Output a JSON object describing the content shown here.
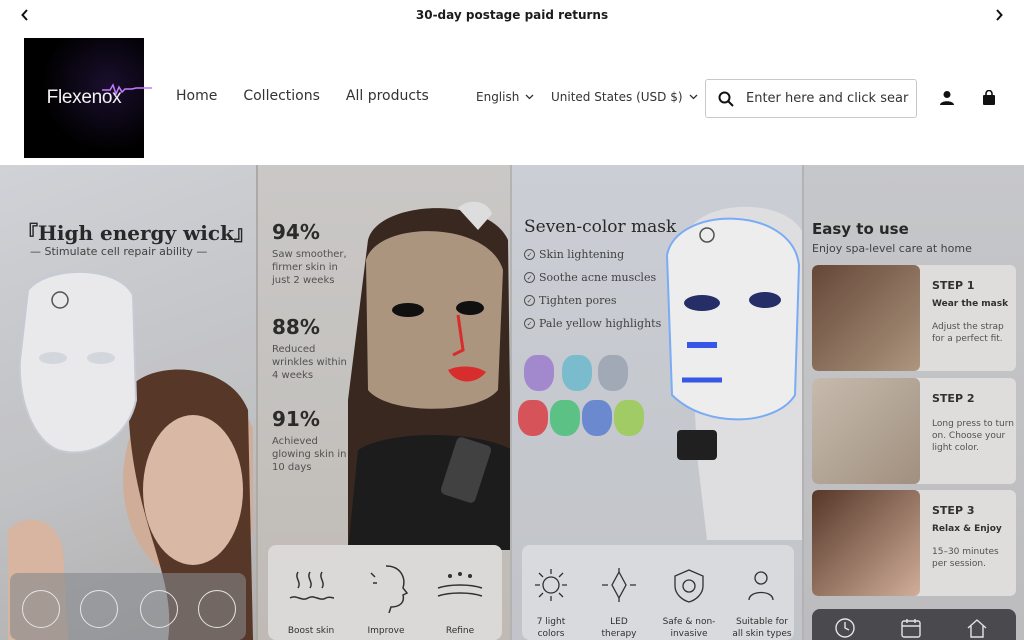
{
  "announcement": {
    "text": "30-day postage paid returns"
  },
  "brand": {
    "name": "Flexenox"
  },
  "nav": {
    "items": [
      {
        "label": "Home"
      },
      {
        "label": "Collections"
      },
      {
        "label": "All products"
      }
    ]
  },
  "language": {
    "selected": "English"
  },
  "country": {
    "selected": "United States (USD $)"
  },
  "search": {
    "placeholder": "Enter here and click sear"
  },
  "hero": {
    "panel1": {
      "title": "『High energy wick』",
      "subtitle": "— Stimulate cell repair ability —"
    },
    "panel2": {
      "stats": [
        {
          "value": "94%",
          "desc": "Saw smoother, firmer skin in just 2 weeks"
        },
        {
          "value": "88%",
          "desc": "Reduced wrinkles within 4 weeks"
        },
        {
          "value": "91%",
          "desc": "Achieved glowing skin in 10 days"
        }
      ],
      "benefits": [
        {
          "label": "Boost skin"
        },
        {
          "label": "Improve"
        },
        {
          "label": "Refine"
        }
      ]
    },
    "panel3": {
      "title": "Seven-color mask",
      "features": [
        {
          "label": "Skin lightening"
        },
        {
          "label": "Soothe acne muscles"
        },
        {
          "label": "Tighten pores"
        },
        {
          "label": "Pale yellow highlights"
        }
      ],
      "badges": [
        {
          "label": "7 light colors"
        },
        {
          "label": "LED therapy"
        },
        {
          "label": "Safe & non-invasive"
        },
        {
          "label": "Suitable for all skin types"
        }
      ],
      "mask_colors": [
        "#a98fd6",
        "#7fc4d6",
        "#a8b0bf",
        "#e0575e",
        "#5fc98a",
        "#6f8fd8",
        "#a8d46a"
      ]
    },
    "panel4": {
      "title": "Easy to use",
      "subtitle": "Enjoy spa-level care at home",
      "steps": [
        {
          "title": "STEP 1",
          "sub": "Wear the mask",
          "desc": "Adjust the strap for a perfect fit."
        },
        {
          "title": "STEP 2",
          "sub": "",
          "desc": "Long press to turn on. Choose your light color."
        },
        {
          "title": "STEP 3",
          "sub": "Relax & Enjoy",
          "desc": "15–30 minutes per session."
        }
      ]
    }
  }
}
